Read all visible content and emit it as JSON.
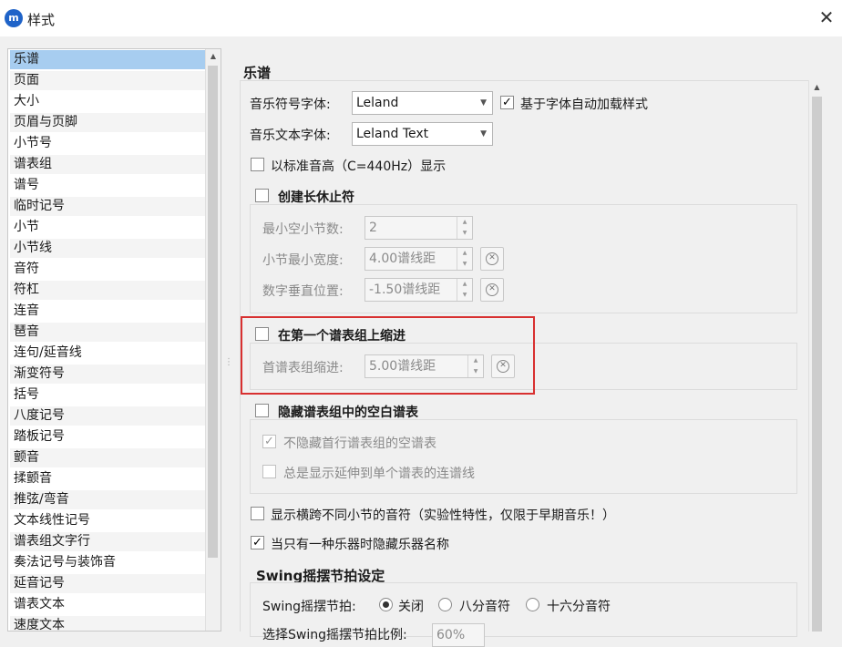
{
  "window": {
    "title": "样式",
    "icon_text": "m"
  },
  "sidebar": {
    "items": [
      {
        "label": "乐谱"
      },
      {
        "label": "页面"
      },
      {
        "label": "大小"
      },
      {
        "label": "页眉与页脚"
      },
      {
        "label": "小节号"
      },
      {
        "label": "谱表组"
      },
      {
        "label": "谱号"
      },
      {
        "label": "临时记号"
      },
      {
        "label": "小节"
      },
      {
        "label": "小节线"
      },
      {
        "label": "音符"
      },
      {
        "label": "符杠"
      },
      {
        "label": "连音"
      },
      {
        "label": "琶音"
      },
      {
        "label": "连句/延音线"
      },
      {
        "label": "渐变符号"
      },
      {
        "label": "括号"
      },
      {
        "label": "八度记号"
      },
      {
        "label": "踏板记号"
      },
      {
        "label": "颤音"
      },
      {
        "label": "揉颤音"
      },
      {
        "label": "推弦/弯音"
      },
      {
        "label": "文本线性记号"
      },
      {
        "label": "谱表组文字行"
      },
      {
        "label": "奏法记号与装饰音"
      },
      {
        "label": "延音记号"
      },
      {
        "label": "谱表文本"
      },
      {
        "label": "速度文本"
      }
    ],
    "selected_index": 0
  },
  "score": {
    "section_title": "乐谱",
    "music_font_label": "音乐符号字体:",
    "music_font_value": "Leland",
    "auto_load_style_label": "基于字体自动加载样式",
    "auto_load_style_checked": true,
    "text_font_label": "音乐文本字体:",
    "text_font_value": "Leland Text",
    "concert_pitch_label": "以标准音高（C=440Hz）显示",
    "concert_pitch_checked": false,
    "mmrest": {
      "title": "创建长休止符",
      "checked": false,
      "min_empty_label": "最小空小节数:",
      "min_empty_value": "2",
      "min_width_label": "小节最小宽度:",
      "min_width_value": "4.00谱线距",
      "num_vpos_label": "数字垂直位置:",
      "num_vpos_value": "-1.50谱线距"
    },
    "indent": {
      "title": "在第一个谱表组上缩进",
      "checked": false,
      "indent_label": "首谱表组缩进:",
      "indent_value": "5.00谱线距"
    },
    "hide_empty": {
      "title": "隐藏谱表组中的空白谱表",
      "checked": false,
      "dont_hide_first_label": "不隐藏首行谱表组的空谱表",
      "dont_hide_first_checked": true,
      "always_bracket_label": "总是显示延伸到单个谱表的连谱线",
      "always_bracket_checked": false
    },
    "cross_measure_label": "显示横跨不同小节的音符（实验性特性，仅限于早期音乐！）",
    "cross_measure_checked": false,
    "hide_instrument_label": "当只有一种乐器时隐藏乐器名称",
    "hide_instrument_checked": true,
    "swing": {
      "title": "Swing摇摆节拍设定",
      "label": "Swing摇摆节拍:",
      "options": [
        "关闭",
        "八分音符",
        "十六分音符"
      ],
      "selected": 0,
      "ratio_label": "选择Swing摇摆节拍比例:",
      "ratio_value": "60%"
    }
  }
}
